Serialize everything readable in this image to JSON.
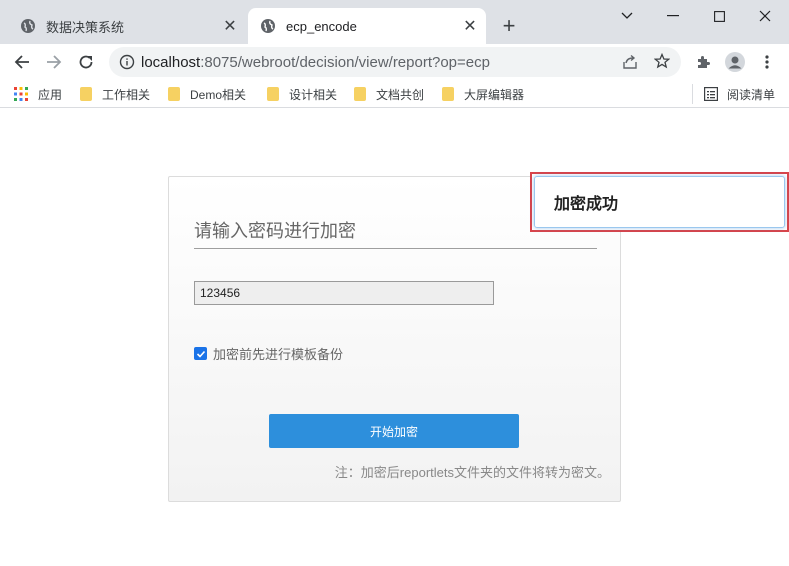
{
  "tabs": [
    {
      "title": "数据决策系统",
      "favicon": "globe-icon",
      "active": false
    },
    {
      "title": "ecp_encode",
      "favicon": "globe-icon",
      "active": true
    }
  ],
  "address_bar": {
    "host": "localhost",
    "rest": ":8075/webroot/decision/view/report?op=ecp"
  },
  "bookmarks": {
    "apps_label": "应用",
    "items": [
      "工作相关",
      "Demo相关",
      "设计相关",
      "文档共创",
      "大屏编辑器"
    ],
    "reading_list": "阅读清单"
  },
  "form": {
    "heading": "请输入密码进行加密",
    "password_value": "123456",
    "backup_label": "加密前先进行模板备份",
    "backup_checked": true,
    "start_button": "开始加密",
    "note": "注：加密后reportlets文件夹的文件将转为密文。"
  },
  "toast": {
    "message": "加密成功"
  },
  "colors": {
    "accent_button": "#2d8fdc",
    "checkbox": "#1a73e8",
    "toast_border": "#d9444a"
  }
}
